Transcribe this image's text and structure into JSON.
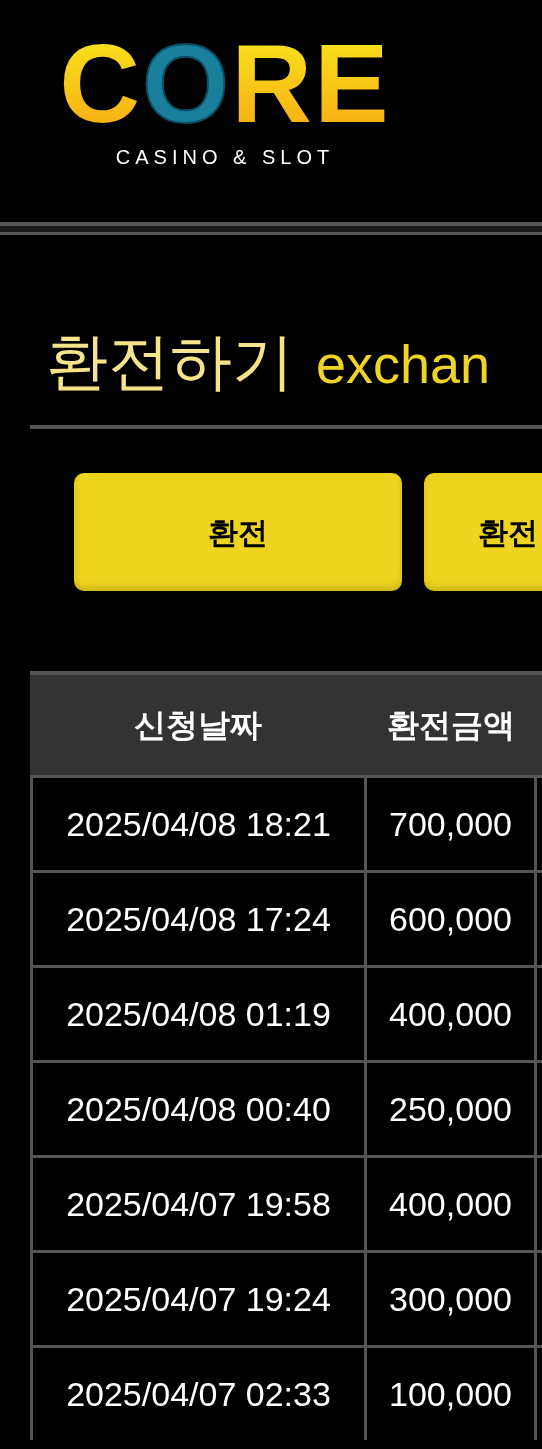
{
  "logo": {
    "letters": "CORE",
    "tagline": "CASINO & SLOT"
  },
  "title": {
    "korean": "환전하기",
    "english": "exchan"
  },
  "buttons": [
    "환전",
    "환전"
  ],
  "table": {
    "columns": [
      "신청날짜",
      "환전금액"
    ],
    "rows": [
      {
        "date": "2025/04/08 18:21",
        "amount": "700,000"
      },
      {
        "date": "2025/04/08 17:24",
        "amount": "600,000"
      },
      {
        "date": "2025/04/08 01:19",
        "amount": "400,000"
      },
      {
        "date": "2025/04/08 00:40",
        "amount": "250,000"
      },
      {
        "date": "2025/04/07 19:58",
        "amount": "400,000"
      },
      {
        "date": "2025/04/07 19:24",
        "amount": "300,000"
      },
      {
        "date": "2025/04/07 02:33",
        "amount": "100,000"
      }
    ]
  }
}
